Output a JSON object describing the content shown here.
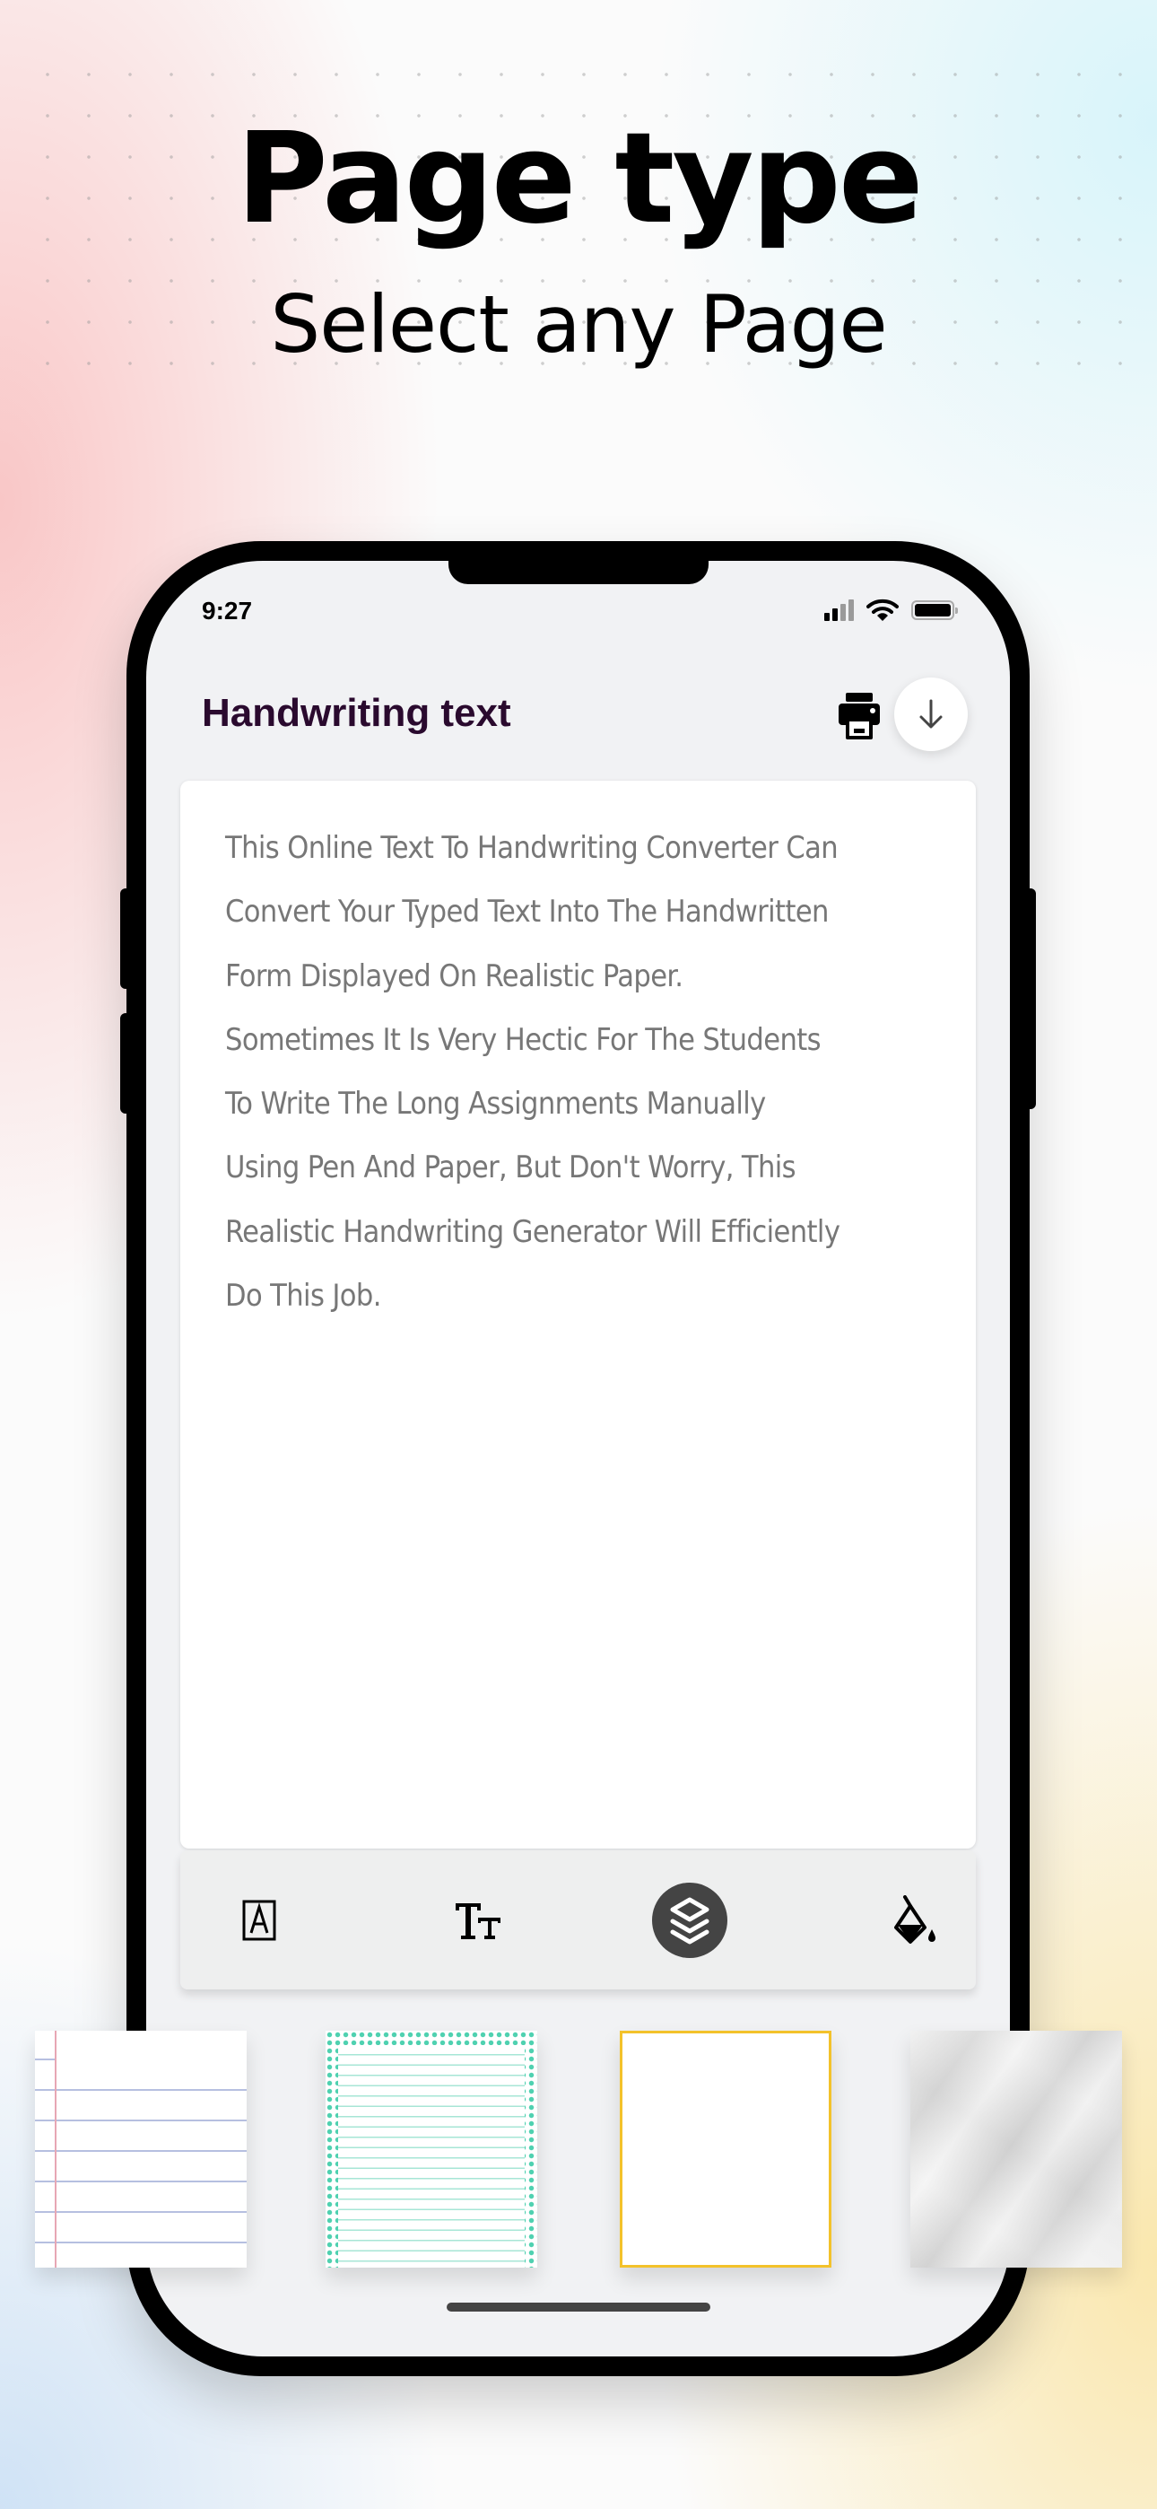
{
  "hero": {
    "title": "Page type",
    "subtitle": "Select any Page"
  },
  "status_bar": {
    "time": "9:27",
    "signal_bars_active": 2,
    "signal_bars_total": 4,
    "wifi": "wifi-icon",
    "battery": "battery-full-icon"
  },
  "header": {
    "title": "Handwriting text",
    "actions": [
      {
        "name": "print",
        "icon": "printer-icon"
      },
      {
        "name": "download",
        "icon": "arrow-down-icon"
      }
    ]
  },
  "editor": {
    "lines": [
      "This Online Text To Handwriting Converter Can",
      "Convert Your Typed Text Into The Handwritten",
      "Form Displayed On Realistic Paper.",
      "Sometimes It Is Very Hectic For The Students",
      "To Write The Long Assignments Manually",
      "Using Pen And Paper, But Don't Worry, This",
      "Realistic Handwriting Generator Will Efficiently",
      "Do This Job."
    ],
    "text_color": "#777777"
  },
  "toolbar": {
    "tools": [
      {
        "name": "font-style",
        "icon": "font-box-icon",
        "active": false
      },
      {
        "name": "text-size",
        "icon": "text-size-icon",
        "active": false
      },
      {
        "name": "page-type",
        "icon": "layers-icon",
        "active": true
      },
      {
        "name": "ink-color",
        "icon": "paint-bucket-icon",
        "active": false
      }
    ]
  },
  "page_types": [
    {
      "name": "ruled-notebook",
      "style": "ruled lines with red margin"
    },
    {
      "name": "teal-dotted-border",
      "style": "teal dotted border with lines"
    },
    {
      "name": "plain-yellow-border",
      "style": "plain white with yellow border"
    },
    {
      "name": "crumpled-paper",
      "style": "crumpled gray paper"
    }
  ],
  "colors": {
    "title_text": "#2a0a2e",
    "active_tool_bg": "#444444",
    "plain_border": "#f3c22b",
    "dot_border": "#4fd1b0",
    "ruled_line": "#b6bfe0",
    "margin_line": "#e7a7b4"
  }
}
